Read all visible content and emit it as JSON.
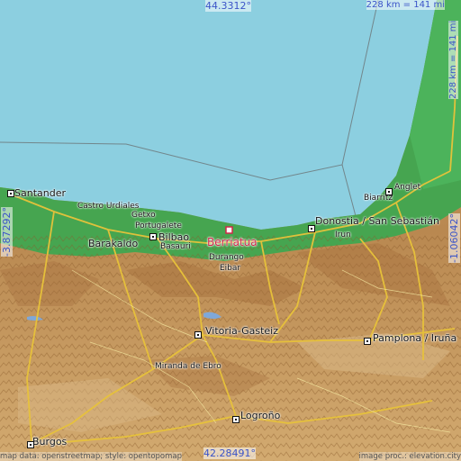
{
  "map": {
    "title": "Berriatua",
    "top_latitude": "44.3312°",
    "bottom_latitude": "42.28491°",
    "left_longitude": "-3.87292°",
    "right_longitude": "-1.06042°",
    "scale": "228 km = 141 mi",
    "attribution_left": "map data: openstreetmap; style: opentopomap",
    "attribution_right": "image proc.: elevation.city",
    "places": {
      "berriatua": "Berriatua",
      "santander": "Santander",
      "castro_urdiales": "Castro Urdiales",
      "getxo": "Getxo",
      "portugalete": "Portugalete",
      "bilbao": "Bilbao",
      "barakaldo": "Barakaldo",
      "basauri": "Basauri",
      "durango": "Durango",
      "eibar": "Eibar",
      "donostia": "Donostia / San Sebastián",
      "irun": "Irun",
      "biarritz": "Biarritz",
      "anglet": "Anglet",
      "vitoria": "Vitoria-Gasteiz",
      "pamplona": "Pamplona / Iruña",
      "miranda": "Miranda de Ebro",
      "logrono": "Logroño",
      "burgos": "Burgos"
    },
    "colors": {
      "sea": "#8ccfe0",
      "lowland": "#3fa650",
      "hills": "#c9a06a",
      "mountains": "#b07a45",
      "roads": "#e8c33a",
      "highlight": "#d0284a",
      "coordinate_text": "#3b54c8"
    }
  }
}
